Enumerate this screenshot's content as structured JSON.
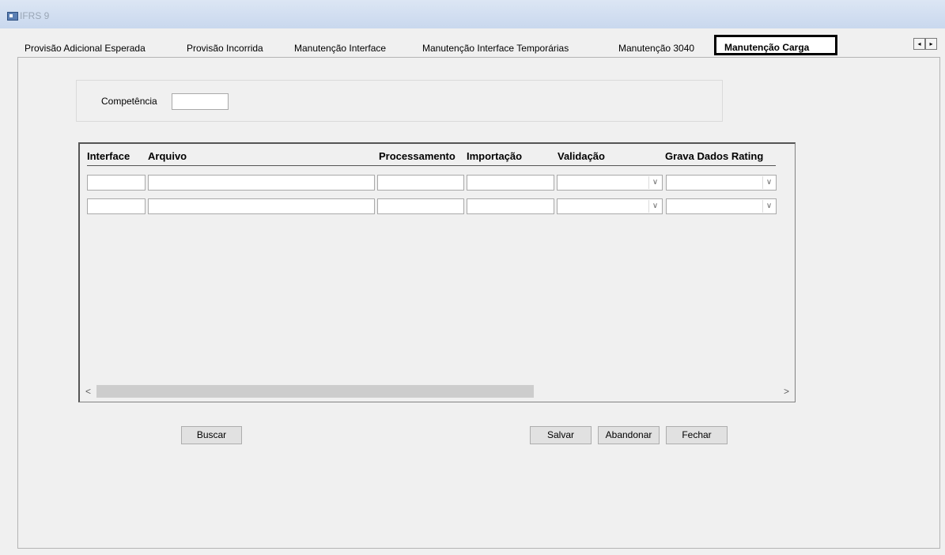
{
  "window": {
    "title": "IFRS 9"
  },
  "tabs": [
    {
      "label": "Provisão Adicional Esperada"
    },
    {
      "label": "Provisão Incorrida"
    },
    {
      "label": "Manutenção Interface"
    },
    {
      "label": "Manutenção Interface Temporárias"
    },
    {
      "label": "Manutenção 3040"
    },
    {
      "label": "Manutenção Carga"
    }
  ],
  "active_tab": "Manutenção Carga",
  "tab_scroll": {
    "left_icon": "◂",
    "right_icon": "▸"
  },
  "filter": {
    "competencia_label": "Competência",
    "competencia_value": ""
  },
  "grid": {
    "columns": [
      "Interface",
      "Arquivo",
      "Processamento",
      "Importação",
      "Validação",
      "Grava Dados Rating"
    ],
    "rows": [
      {
        "interface": "",
        "arquivo": "",
        "processamento": "",
        "importacao": "",
        "validacao": "",
        "grava_dados_rating": ""
      },
      {
        "interface": "",
        "arquivo": "",
        "processamento": "",
        "importacao": "",
        "validacao": "",
        "grava_dados_rating": ""
      }
    ],
    "scroll_left_icon": "<",
    "scroll_right_icon": ">"
  },
  "buttons": {
    "buscar": "Buscar",
    "salvar": "Salvar",
    "abandonar": "Abandonar",
    "fechar": "Fechar"
  },
  "icons": {
    "dropdown": "chevron-down-icon",
    "dropdown_glyph": "∨"
  }
}
